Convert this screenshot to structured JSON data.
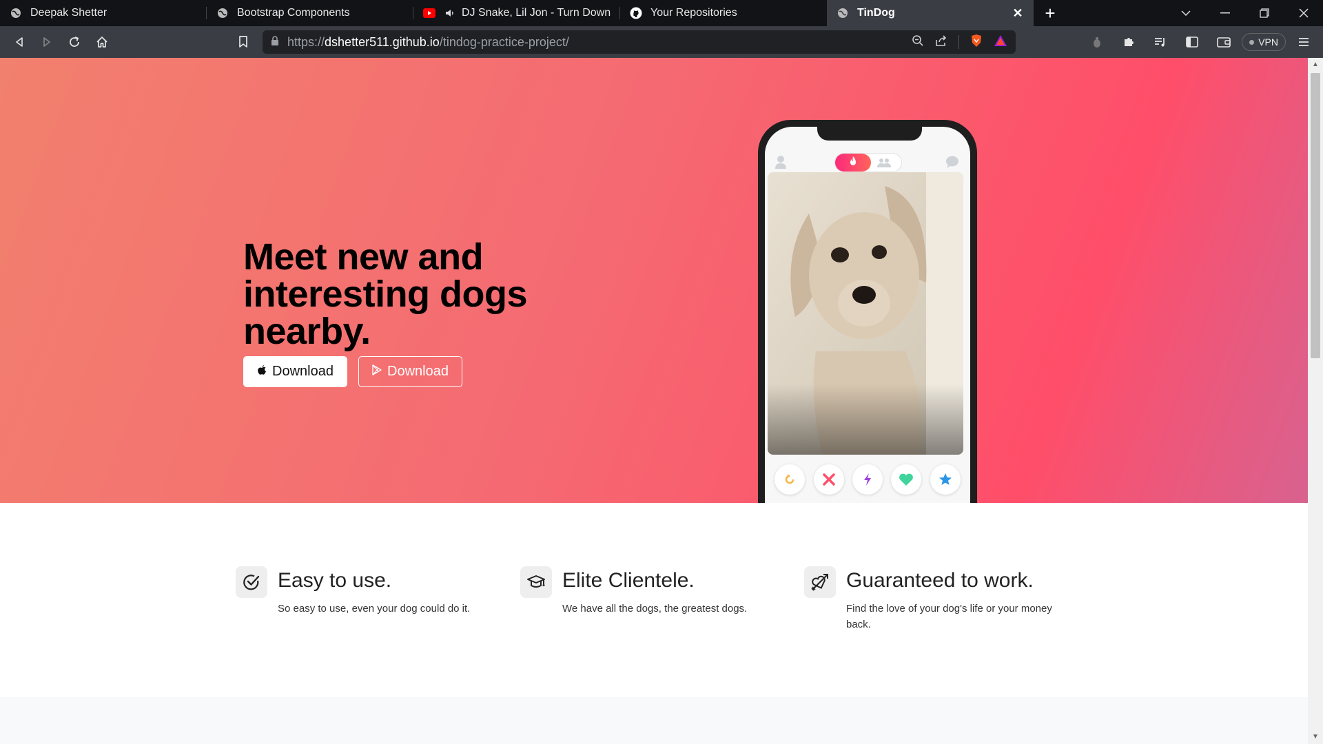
{
  "browser": {
    "tabs": [
      {
        "title": "Deepak Shetter",
        "icon": "globe-icon"
      },
      {
        "title": "Bootstrap Components",
        "icon": "globe-icon"
      },
      {
        "title": "DJ Snake, Lil Jon - Turn Down for W",
        "icon": "youtube-icon"
      },
      {
        "title": "Your Repositories",
        "icon": "github-icon"
      },
      {
        "title": "TinDog",
        "icon": "globe-icon",
        "active": true
      }
    ],
    "url_scheme": "https://",
    "url_host": "dshetter511.github.io",
    "url_path": "/tindog-practice-project/",
    "vpn_label": "VPN"
  },
  "hero": {
    "title": "Meet new and interesting dogs nearby.",
    "apple_download_label": "Download",
    "google_download_label": "Download",
    "gradient_colors": [
      "#f2806e",
      "#ff4e69"
    ]
  },
  "features": [
    {
      "title": "Easy to use.",
      "text": "So easy to use, even your dog could do it.",
      "icon": "check-circle-icon"
    },
    {
      "title": "Elite Clientele.",
      "text": "We have all the dogs, the greatest dogs.",
      "icon": "graduation-cap-icon"
    },
    {
      "title": "Guaranteed to work.",
      "text": "Find the love of your dog's life or your money back.",
      "icon": "heart-arrow-icon"
    }
  ]
}
